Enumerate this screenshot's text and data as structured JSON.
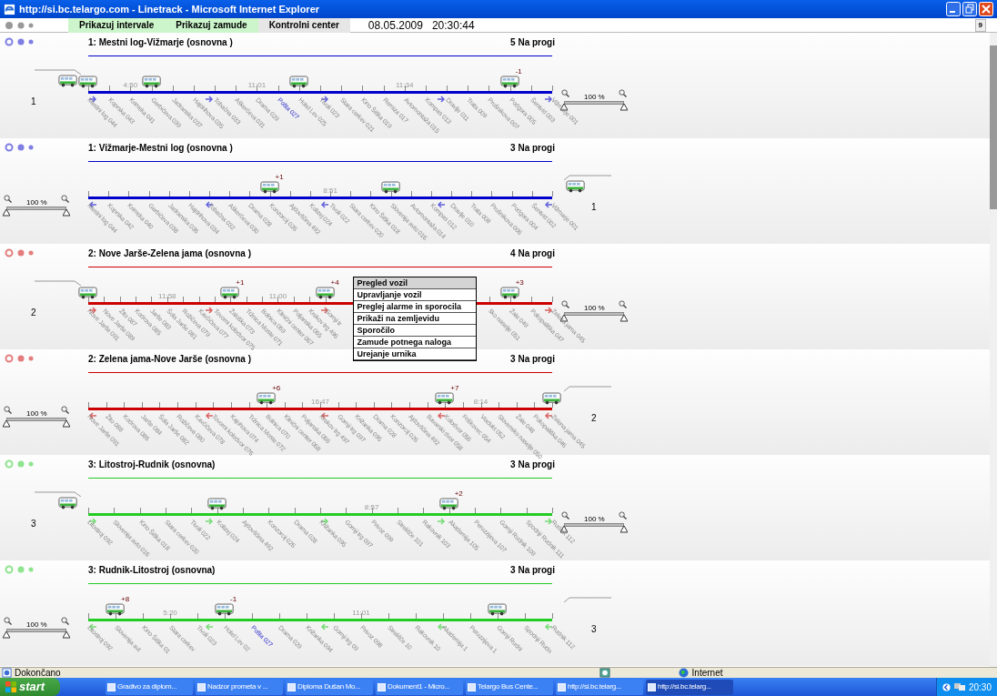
{
  "window": {
    "title": "http://si.bc.telargo.com - Linetrack - Microsoft Internet Explorer"
  },
  "toolbar": {
    "toggles": [
      {
        "label": "Prikazuj intervale",
        "on": true
      },
      {
        "label": "Prikazuj zamude",
        "on": true
      },
      {
        "label": "Kontrolni center",
        "on": false
      }
    ],
    "datetime": "08.05.2009   20:30:44",
    "badge": "9"
  },
  "lines": [
    {
      "title": "1: Mestni log-Vižmarje (osnovna )",
      "count": "5 Na progi",
      "color": "#0000cc",
      "kind": "forward",
      "zoom": {
        "label": "100 %",
        "level": 1
      },
      "depot": {
        "count": "1",
        "vehicle": true
      },
      "stops": [
        {
          "name": "Mestni log 044",
          "vehicle": true,
          "highlighted": false
        },
        {
          "name": "Koprska 043",
          "vehicle": false,
          "highlighted": false
        },
        {
          "name": "Krimska 041",
          "vehicle": false,
          "highlighted": false,
          "interval": "4:50"
        },
        {
          "name": "Gerbičeva 039",
          "vehicle": true,
          "highlighted": false
        },
        {
          "name": "Jadranska 037",
          "vehicle": false,
          "highlighted": false
        },
        {
          "name": "Hajdrihova 035",
          "vehicle": false,
          "highlighted": false
        },
        {
          "name": "Tobačna 033",
          "vehicle": false,
          "highlighted": false
        },
        {
          "name": "Aškerčeva 031",
          "vehicle": false,
          "highlighted": false
        },
        {
          "name": "Drama 029",
          "vehicle": false,
          "highlighted": false,
          "interval": "11:01"
        },
        {
          "name": "Pošta 027",
          "vehicle": false,
          "highlighted": true
        },
        {
          "name": "Hotel Lev 025",
          "vehicle": true,
          "highlighted": false
        },
        {
          "name": "Tivoli 023",
          "vehicle": false,
          "highlighted": false
        },
        {
          "name": "Stara cerkev 021",
          "vehicle": false,
          "highlighted": false
        },
        {
          "name": "Kino Šiška 019",
          "vehicle": false,
          "highlighted": false
        },
        {
          "name": "Remiza 017",
          "vehicle": false,
          "highlighted": false
        },
        {
          "name": "Avtomontaža 015",
          "vehicle": false,
          "highlighted": false,
          "interval": "11:34"
        },
        {
          "name": "Kompas 013",
          "vehicle": false,
          "highlighted": false
        },
        {
          "name": "Dravlje 011",
          "vehicle": false,
          "highlighted": false
        },
        {
          "name": "Trata 009",
          "vehicle": false,
          "highlighted": false
        },
        {
          "name": "Prušnikova 007",
          "vehicle": false,
          "highlighted": false
        },
        {
          "name": "Podgora 005",
          "vehicle": true,
          "highlighted": false,
          "delay": "-1"
        },
        {
          "name": "Šentvid 003",
          "vehicle": false,
          "highlighted": false
        },
        {
          "name": "Vižmarje 001",
          "vehicle": false,
          "highlighted": false
        }
      ]
    },
    {
      "title": "1: Vižmarje-Mestni log (osnovna )",
      "count": "3 Na progi",
      "color": "#0000cc",
      "kind": "backward",
      "zoom": {
        "label": "100 %",
        "level": 1
      },
      "depot": {
        "count": "1",
        "vehicle": true
      },
      "stops": [
        {
          "name": "Mestni log 044",
          "vehicle": false,
          "highlighted": false
        },
        {
          "name": "Koprska 042",
          "vehicle": false,
          "highlighted": false
        },
        {
          "name": "Krimska 040",
          "vehicle": false,
          "highlighted": false
        },
        {
          "name": "Gerbičeva 038",
          "vehicle": false,
          "highlighted": false
        },
        {
          "name": "Jadranska 036",
          "vehicle": false,
          "highlighted": false
        },
        {
          "name": "Hajdrihova 034",
          "vehicle": false,
          "highlighted": false
        },
        {
          "name": "Tobačna 032",
          "vehicle": false,
          "highlighted": false
        },
        {
          "name": "Aškerčeva 030",
          "vehicle": false,
          "highlighted": false
        },
        {
          "name": "Drama 028",
          "vehicle": false,
          "highlighted": false
        },
        {
          "name": "Konzorcij 026",
          "vehicle": true,
          "highlighted": false,
          "delay": "+1"
        },
        {
          "name": "Ajdovščina 492",
          "vehicle": false,
          "highlighted": false
        },
        {
          "name": "Kolizej 024",
          "vehicle": false,
          "highlighted": false
        },
        {
          "name": "Tivoli 022",
          "vehicle": false,
          "highlighted": false,
          "interval": "8:51"
        },
        {
          "name": "Stara cerkev 020",
          "vehicle": false,
          "highlighted": false
        },
        {
          "name": "Kino Šiška 018",
          "vehicle": false,
          "highlighted": false
        },
        {
          "name": "Slovenija avto 016",
          "vehicle": true,
          "highlighted": false
        },
        {
          "name": "Avtomontaža 014",
          "vehicle": false,
          "highlighted": false
        },
        {
          "name": "Kompas 012",
          "vehicle": false,
          "highlighted": false
        },
        {
          "name": "Dravlje 010",
          "vehicle": false,
          "highlighted": false
        },
        {
          "name": "Trata 008",
          "vehicle": false,
          "highlighted": false
        },
        {
          "name": "Prušnikova 006",
          "vehicle": false,
          "highlighted": false
        },
        {
          "name": "Podgora 004",
          "vehicle": false,
          "highlighted": false
        },
        {
          "name": "Šentvid 002",
          "vehicle": false,
          "highlighted": false
        },
        {
          "name": "Vižmarje 001",
          "vehicle": false,
          "highlighted": false
        }
      ]
    },
    {
      "title": "2: Nove Jarše-Zelena jama (osnovna )",
      "count": "4 Na progi",
      "color": "#cc0000",
      "kind": "forward",
      "zoom": {
        "label": "100 %",
        "level": 1
      },
      "depot": {
        "count": "2",
        "vehicle": false
      },
      "stops": [
        {
          "name": "Nove Jarše 091",
          "vehicle": true,
          "highlighted": false
        },
        {
          "name": "Nove Jarše 089",
          "vehicle": false,
          "highlighted": false
        },
        {
          "name": "Žito 087",
          "vehicle": false,
          "highlighted": false
        },
        {
          "name": "Kodrova 085",
          "vehicle": false,
          "highlighted": false
        },
        {
          "name": "Jarše 083",
          "vehicle": false,
          "highlighted": false
        },
        {
          "name": "Šola Jarše 081",
          "vehicle": false,
          "highlighted": false,
          "interval": "11:58"
        },
        {
          "name": "Rožičeva 079",
          "vehicle": false,
          "highlighted": false
        },
        {
          "name": "Kavčičeva 077",
          "vehicle": false,
          "highlighted": false
        },
        {
          "name": "Tovorni kolodvor 075",
          "vehicle": false,
          "highlighted": false
        },
        {
          "name": "Žaloška 073",
          "vehicle": true,
          "highlighted": false,
          "delay": "+1"
        },
        {
          "name": "Tržnica Moste 071",
          "vehicle": false,
          "highlighted": false
        },
        {
          "name": "Bolnica 069",
          "vehicle": false,
          "highlighted": false
        },
        {
          "name": "Klinični center 067",
          "vehicle": false,
          "highlighted": false,
          "interval": "11:00"
        },
        {
          "name": "Poljanska 065",
          "vehicle": false,
          "highlighted": false
        },
        {
          "name": "Krekov trg 496",
          "vehicle": false,
          "highlighted": false
        },
        {
          "name": "Gornji tr",
          "vehicle": true,
          "highlighted": false,
          "delay": "+4",
          "context_menu": {
            "items": [
              {
                "label": "Pregled vozil",
                "selected": true
              },
              {
                "label": "Upravljanje vozil",
                "selected": false
              },
              {
                "label": "Preglej alarme in sporocila",
                "selected": false
              },
              {
                "label": "Prikaži na zemljevidu",
                "selected": false
              },
              {
                "label": "Sporočilo",
                "selected": false
              },
              {
                "label": "Zamude potnega naloga",
                "selected": false
              },
              {
                "label": "Urejanje urnika",
                "selected": false
              }
            ]
          }
        },
        {
          "name": "ško naselje 051",
          "vehicle": false,
          "highlighted": false
        },
        {
          "name": "Žale 049",
          "vehicle": true,
          "highlighted": false,
          "delay": "+3"
        },
        {
          "name": "Pokopališka 047",
          "vehicle": false,
          "highlighted": false
        },
        {
          "name": "Zelena jama 045",
          "vehicle": false,
          "highlighted": false
        }
      ]
    },
    {
      "title": "2: Zelena jama-Nove Jarše (osnovna )",
      "count": "3 Na progi",
      "color": "#cc0000",
      "kind": "backward",
      "zoom": {
        "label": "100 %",
        "level": 1
      },
      "depot": {
        "count": "2",
        "vehicle": false
      },
      "stops": [
        {
          "name": "Nove Jarše 091",
          "vehicle": false,
          "highlighted": false
        },
        {
          "name": "Žito 088",
          "vehicle": false,
          "highlighted": false
        },
        {
          "name": "Kodrova 086",
          "vehicle": false,
          "highlighted": false
        },
        {
          "name": "Jarše 084",
          "vehicle": false,
          "highlighted": false
        },
        {
          "name": "Šola Jarše 082",
          "vehicle": false,
          "highlighted": false
        },
        {
          "name": "Rožičeva 080",
          "vehicle": false,
          "highlighted": false
        },
        {
          "name": "Kavčičeva 078",
          "vehicle": false,
          "highlighted": false
        },
        {
          "name": "Tovorni kolodvor 076",
          "vehicle": false,
          "highlighted": false
        },
        {
          "name": "Kajuhova 074",
          "vehicle": false,
          "highlighted": false
        },
        {
          "name": "Tržnica Moste 072",
          "vehicle": false,
          "highlighted": false
        },
        {
          "name": "Bolnica 070",
          "vehicle": true,
          "highlighted": false,
          "delay": "+6"
        },
        {
          "name": "Klinični center 068",
          "vehicle": false,
          "highlighted": false
        },
        {
          "name": "Poljanska 066",
          "vehicle": false,
          "highlighted": false
        },
        {
          "name": "Krekov trg 497",
          "vehicle": false,
          "highlighted": false,
          "interval": "16:47"
        },
        {
          "name": "Gornji trg 097",
          "vehicle": false,
          "highlighted": false
        },
        {
          "name": "Križanka 095",
          "vehicle": false,
          "highlighted": false
        },
        {
          "name": "Drama 028",
          "vehicle": false,
          "highlighted": false
        },
        {
          "name": "Konzorcij 026",
          "vehicle": false,
          "highlighted": false
        },
        {
          "name": "Ajdovščina 492",
          "vehicle": false,
          "highlighted": false
        },
        {
          "name": "Bavarski dvor 058",
          "vehicle": false,
          "highlighted": false
        },
        {
          "name": "Kolodvor 056",
          "vehicle": true,
          "highlighted": false,
          "delay": "+7"
        },
        {
          "name": "Friškovec 054",
          "vehicle": false,
          "highlighted": false
        },
        {
          "name": "Viadukt 052",
          "vehicle": false,
          "highlighted": false,
          "interval": "8:14"
        },
        {
          "name": "Slovensko naselje 050",
          "vehicle": false,
          "highlighted": false
        },
        {
          "name": "Žale 048",
          "vehicle": false,
          "highlighted": false
        },
        {
          "name": "Pokopališka 046",
          "vehicle": false,
          "highlighted": false
        },
        {
          "name": "Zelena jama 045",
          "vehicle": true,
          "highlighted": false
        }
      ]
    },
    {
      "title": "3: Litostroj-Rudnik (osnovna)",
      "count": "3 Na progi",
      "color": "#22cc22",
      "kind": "forward",
      "zoom": {
        "label": "100 %",
        "level": 1
      },
      "depot": {
        "count": "3",
        "vehicle": true
      },
      "stops": [
        {
          "name": "Litostroj 092",
          "vehicle": false,
          "highlighted": false
        },
        {
          "name": "Slovenija avto 016",
          "vehicle": false,
          "highlighted": false
        },
        {
          "name": "Kino Šiška 018",
          "vehicle": false,
          "highlighted": false
        },
        {
          "name": "Stara cerkev 020",
          "vehicle": false,
          "highlighted": false
        },
        {
          "name": "Tivoli 022",
          "vehicle": false,
          "highlighted": false
        },
        {
          "name": "Kolizej 024",
          "vehicle": true,
          "highlighted": false
        },
        {
          "name": "Ajdovščina 492",
          "vehicle": false,
          "highlighted": false
        },
        {
          "name": "Konzorcij 026",
          "vehicle": false,
          "highlighted": false
        },
        {
          "name": "Drama 028",
          "vehicle": false,
          "highlighted": false
        },
        {
          "name": "Križanka 095",
          "vehicle": false,
          "highlighted": false
        },
        {
          "name": "Gornji trg 097",
          "vehicle": false,
          "highlighted": false
        },
        {
          "name": "Privoz 099",
          "vehicle": false,
          "highlighted": false,
          "interval": "8:57"
        },
        {
          "name": "Strelišče 101",
          "vehicle": false,
          "highlighted": false
        },
        {
          "name": "Rakovnik 103",
          "vehicle": false,
          "highlighted": false
        },
        {
          "name": "Akademija 105",
          "vehicle": true,
          "highlighted": false,
          "delay": "+2"
        },
        {
          "name": "Peruzzijeva 107",
          "vehicle": false,
          "highlighted": false
        },
        {
          "name": "Gornji Rudnik 109",
          "vehicle": false,
          "highlighted": false
        },
        {
          "name": "Spodnji Rudnik 111",
          "vehicle": false,
          "highlighted": false
        },
        {
          "name": "Rudnik 112",
          "vehicle": false,
          "highlighted": false
        }
      ]
    },
    {
      "title": "3: Rudnik-Litostroj (osnovna)",
      "count": "3 Na progi",
      "color": "#22cc22",
      "kind": "backward",
      "zoom": {
        "label": "100 %",
        "level": 1
      },
      "depot": {
        "count": "3",
        "vehicle": false
      },
      "stops": [
        {
          "name": "Litostroj 092",
          "vehicle": false,
          "highlighted": false
        },
        {
          "name": "Slovenija avt",
          "vehicle": true,
          "highlighted": false,
          "delay": "+8"
        },
        {
          "name": "Kino Šiška 01",
          "vehicle": false,
          "highlighted": false
        },
        {
          "name": "Stara cerkev",
          "vehicle": false,
          "highlighted": false,
          "interval": "5:20"
        },
        {
          "name": "Tivoli 023",
          "vehicle": false,
          "highlighted": false
        },
        {
          "name": "Hotel Lev 02",
          "vehicle": true,
          "highlighted": false,
          "delay": "-1"
        },
        {
          "name": "Pošta 027",
          "vehicle": false,
          "highlighted": true
        },
        {
          "name": "Drama 029",
          "vehicle": false,
          "highlighted": false
        },
        {
          "name": "Križanka 094",
          "vehicle": false,
          "highlighted": false
        },
        {
          "name": "Gornji trg 09",
          "vehicle": false,
          "highlighted": false
        },
        {
          "name": "Privoz 098",
          "vehicle": false,
          "highlighted": false,
          "interval": "11:01"
        },
        {
          "name": "Strelišče 10",
          "vehicle": false,
          "highlighted": false
        },
        {
          "name": "Rakovnik 10",
          "vehicle": false,
          "highlighted": false
        },
        {
          "name": "Akademija 1",
          "vehicle": false,
          "highlighted": false
        },
        {
          "name": "Peruzzijeva 1",
          "vehicle": false,
          "highlighted": false
        },
        {
          "name": "Gornji Rudni",
          "vehicle": true,
          "highlighted": false
        },
        {
          "name": "Spodnji Rudn",
          "vehicle": false,
          "highlighted": false
        },
        {
          "name": "Rudnik 112",
          "vehicle": false,
          "highlighted": false
        }
      ]
    }
  ],
  "status_bar": {
    "text": "Dokončano",
    "zone": "Internet"
  },
  "taskbar": {
    "start": "start",
    "items": [
      {
        "label": "Gradivo za diplom...",
        "selected": false
      },
      {
        "label": "Nadzor prometa v ...",
        "selected": false
      },
      {
        "label": "Diploma Dušan Mo...",
        "selected": false
      },
      {
        "label": "Dokument1 - Micro...",
        "selected": false
      },
      {
        "label": "Telargo Bus Cente...",
        "selected": false
      },
      {
        "label": "http://si.bc.telarg...",
        "selected": false
      },
      {
        "label": "http://si.bc.telarg...",
        "selected": true
      }
    ],
    "clock": "20:30"
  }
}
